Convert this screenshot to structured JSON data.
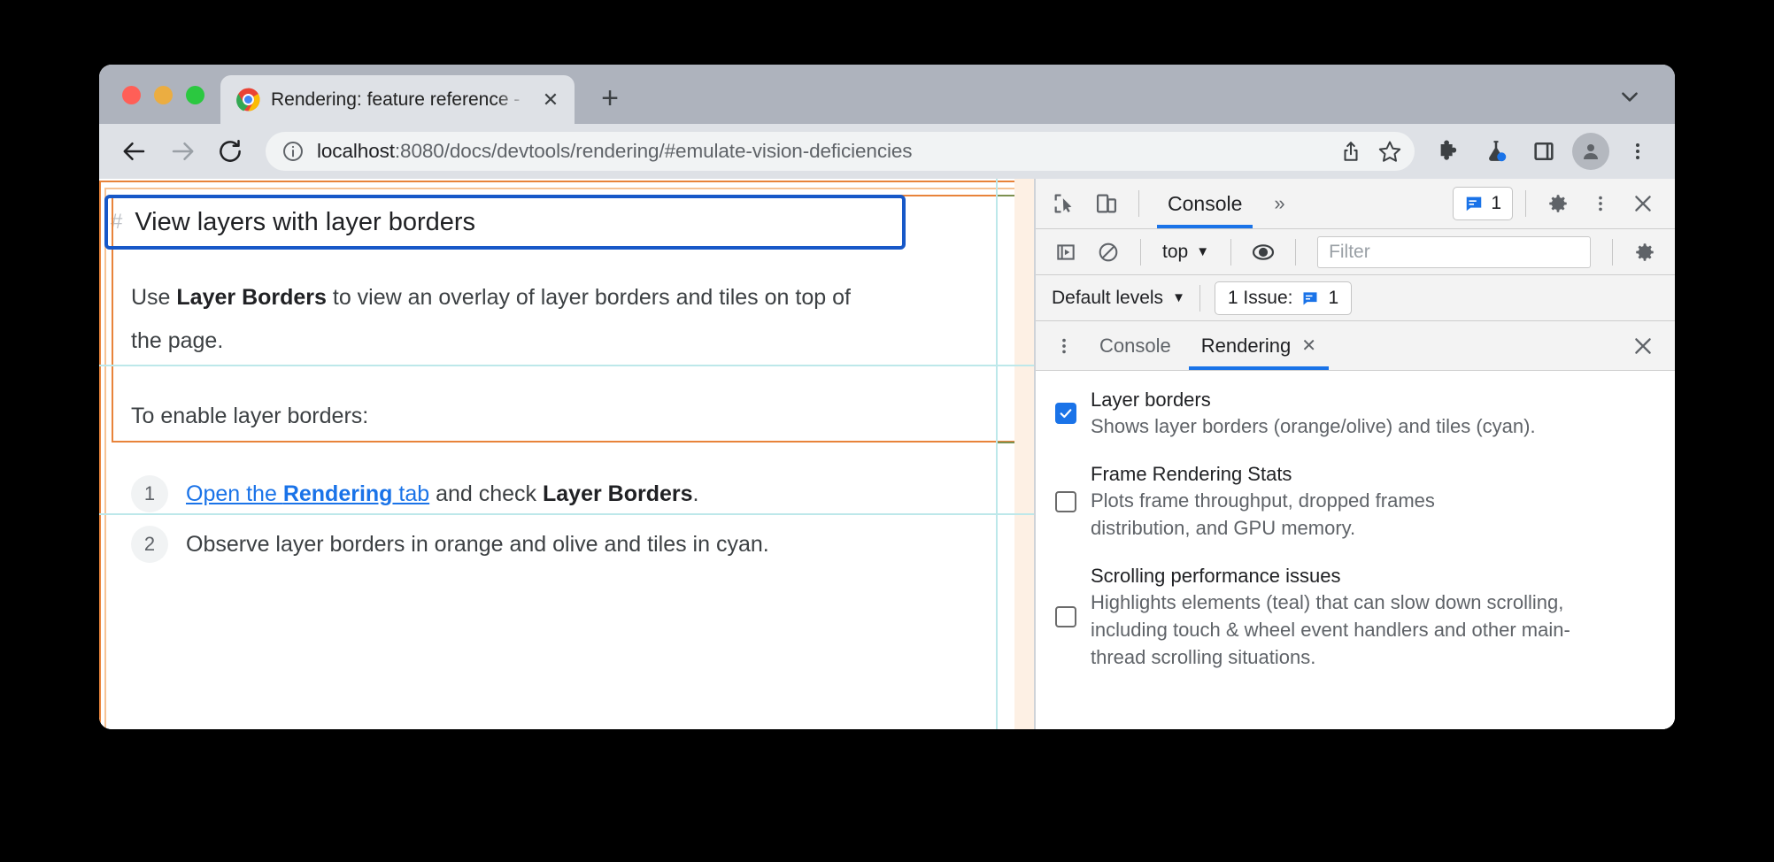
{
  "window": {
    "traffic_lights": [
      "close",
      "minimize",
      "maximize"
    ],
    "tab": {
      "title": "Rendering: feature reference -",
      "close_label": "✕",
      "favicon": "chrome-logo-icon"
    },
    "new_tab_label": "+",
    "tab_list_icon": "chevron-down-icon"
  },
  "toolbar": {
    "back_icon": "back-arrow-icon",
    "forward_icon": "forward-arrow-icon",
    "reload_icon": "reload-icon",
    "site_info_icon": "info-circle-icon",
    "url_scheme_host": "localhost",
    "url_rest": ":8080/docs/devtools/rendering/#emulate-vision-deficiencies",
    "share_icon": "share-icon",
    "bookmark_icon": "star-icon",
    "extensions_icon": "puzzle-piece-icon",
    "labs_icon": "flask-icon",
    "side_panel_icon": "side-panel-icon",
    "avatar_icon": "profile-avatar-icon",
    "menu_icon": "three-dot-menu-icon"
  },
  "page": {
    "heading_hash": "#",
    "heading": "View layers with layer borders",
    "paragraph_1_pre": "Use ",
    "paragraph_1_bold": "Layer Borders",
    "paragraph_1_post": " to view an overlay of layer borders and tiles on top of the page.",
    "paragraph_2": "To enable layer borders:",
    "steps": [
      {
        "number": "1",
        "link_pre": "Open the ",
        "link_bold": "Rendering",
        "link_post": " tab",
        "text_mid": " and check ",
        "text_bold": "Layer Borders",
        "text_end": "."
      },
      {
        "number": "2",
        "text": "Observe layer borders in orange and olive and tiles in cyan."
      }
    ],
    "overlay_colors": {
      "layer_border_orange": "#e8833a",
      "layer_border_olive": "#8a9a5b",
      "tile_cyan": "#bde8ea",
      "focus_ring_blue": "#1758c8"
    }
  },
  "devtools": {
    "inspect_icon": "inspect-cursor-icon",
    "device_toolbar_icon": "device-toggle-icon",
    "main_tab": "Console",
    "more_tabs_label": "»",
    "messages_badge_icon": "message-bubble-icon",
    "messages_badge_count": "1",
    "settings_icon": "gear-icon",
    "menu_icon": "three-dot-menu-icon",
    "close_icon": "close-icon",
    "console_toolbar": {
      "sidebar_icon": "console-sidebar-icon",
      "clear_icon": "clear-console-icon",
      "context": "top",
      "context_caret": "▼",
      "eye_icon": "live-expression-icon",
      "filter_placeholder": "Filter",
      "settings_icon": "gear-icon"
    },
    "levels_row": {
      "levels_label": "Default levels",
      "levels_caret": "▼",
      "issues_label": "1 Issue:",
      "issues_icon": "issue-bubble-icon",
      "issues_count": "1"
    },
    "drawer": {
      "menu_icon": "three-dot-menu-icon",
      "tabs": [
        {
          "label": "Console",
          "active": false,
          "closable": false
        },
        {
          "label": "Rendering",
          "active": true,
          "closable": true,
          "close_label": "✕"
        }
      ],
      "close_icon": "close-icon"
    },
    "rendering_options": [
      {
        "checked": true,
        "title": "Layer borders",
        "description": "Shows layer borders (orange/olive) and tiles (cyan)."
      },
      {
        "checked": false,
        "title": "Frame Rendering Stats",
        "description": "Plots frame throughput, dropped frames distribution, and GPU memory."
      },
      {
        "checked": false,
        "title": "Scrolling performance issues",
        "description": "Highlights elements (teal) that can slow down scrolling, including touch & wheel event handlers and other main-thread scrolling situations."
      }
    ]
  }
}
